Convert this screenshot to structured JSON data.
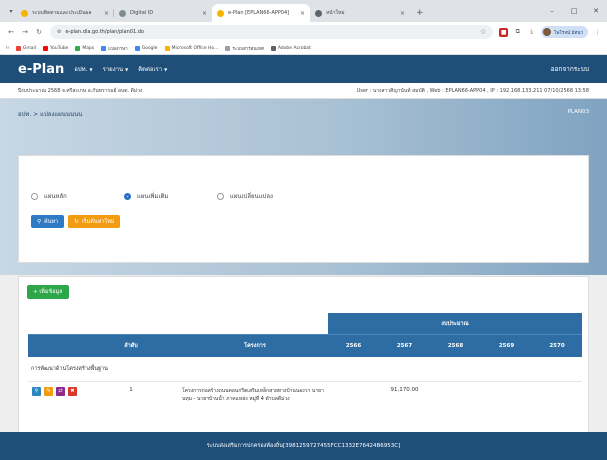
{
  "browser": {
    "tabs": [
      {
        "title": "ระบบติดตามและประเมินผล",
        "favicon_color": "#f4b400",
        "active": false
      },
      {
        "title": "Digital ID",
        "favicon_color": "#7f8c8d",
        "active": false
      },
      {
        "title": "e-Plan [EPLAN66-APP04]",
        "favicon_color": "#f4b400",
        "active": true
      },
      {
        "title": "หน้าใหม่",
        "favicon_color": "#5f6368",
        "active": false
      }
    ],
    "url": "e-plan.dla.go.th/plan/plan01.do",
    "profile_name": "ไพโรจน์ มัทนา",
    "bookmarks": [
      {
        "label": "Gmail",
        "color": "#ea4335"
      },
      {
        "label": "YouTube",
        "color": "#ff0000"
      },
      {
        "label": "Maps",
        "color": "#34a853"
      },
      {
        "label": "แปลภาษา",
        "color": "#4285f4"
      },
      {
        "label": "Google",
        "color": "#4285f4"
      },
      {
        "label": "Microsoft Office Ho...",
        "color": "#f4b400"
      },
      {
        "label": "ระบบสารสนเทศ",
        "color": "#9aa0a6"
      },
      {
        "label": "Adobe Acrobat",
        "color": "#5f6368"
      }
    ]
  },
  "nav": {
    "brand": "e-Plan",
    "menus": [
      "อปท.",
      "รายงาน",
      "ติดต่อเรา"
    ],
    "logout": "ออกจากระบบ"
  },
  "info": {
    "left": "ปีงบประมาณ 2568  จ.ศรีสะเกษ อ.กันทรารมย์ อบต. ดีม่วง",
    "right": "User : นางสาวศิญานันท์ สมบัติ , Web : EPLAN66-APP04 , IP : 192.168.133.211 07/10/2568 13:58"
  },
  "breadcrumb": {
    "text": "อปท. > แปลงแผนนนนน",
    "code": "PLAN03"
  },
  "plan_options": {
    "options": [
      "แผนหลัก",
      "แผนเพิ่มเติม",
      "แผนเปลี่ยนแปลง"
    ],
    "selected_index": 1,
    "search_label": "ค้นหา",
    "reset_label": "เริ่มค้นหาใหม่"
  },
  "table": {
    "add_label": "+ เพิ่มข้อมูล",
    "budget_group": "งบประมาณ",
    "columns": [
      "ลำดับ",
      "โครงการ",
      "2566",
      "2567",
      "2568",
      "2569",
      "2570"
    ],
    "category": "การพัฒนาด้านโครงสร้างพื้นฐาน",
    "rows": [
      {
        "no": "1",
        "name": "โครงการก่อสร้างถนนคอนกรีตเสริมเหล็กสายทางบ้านนองวา นายา นหฺม - นายฯบ้านน้ำ ภาคแหล่ง หมู่ที่ 4 ตำบลดีม่วง",
        "y2566": "",
        "y2567": "91,170.00",
        "y2568": "",
        "y2569": "",
        "y2570": ""
      }
    ]
  },
  "footer": "ระบบส่งเสริมการปกครองท้องถิ่น[3981259727455FCC1332E76424B6953C]"
}
